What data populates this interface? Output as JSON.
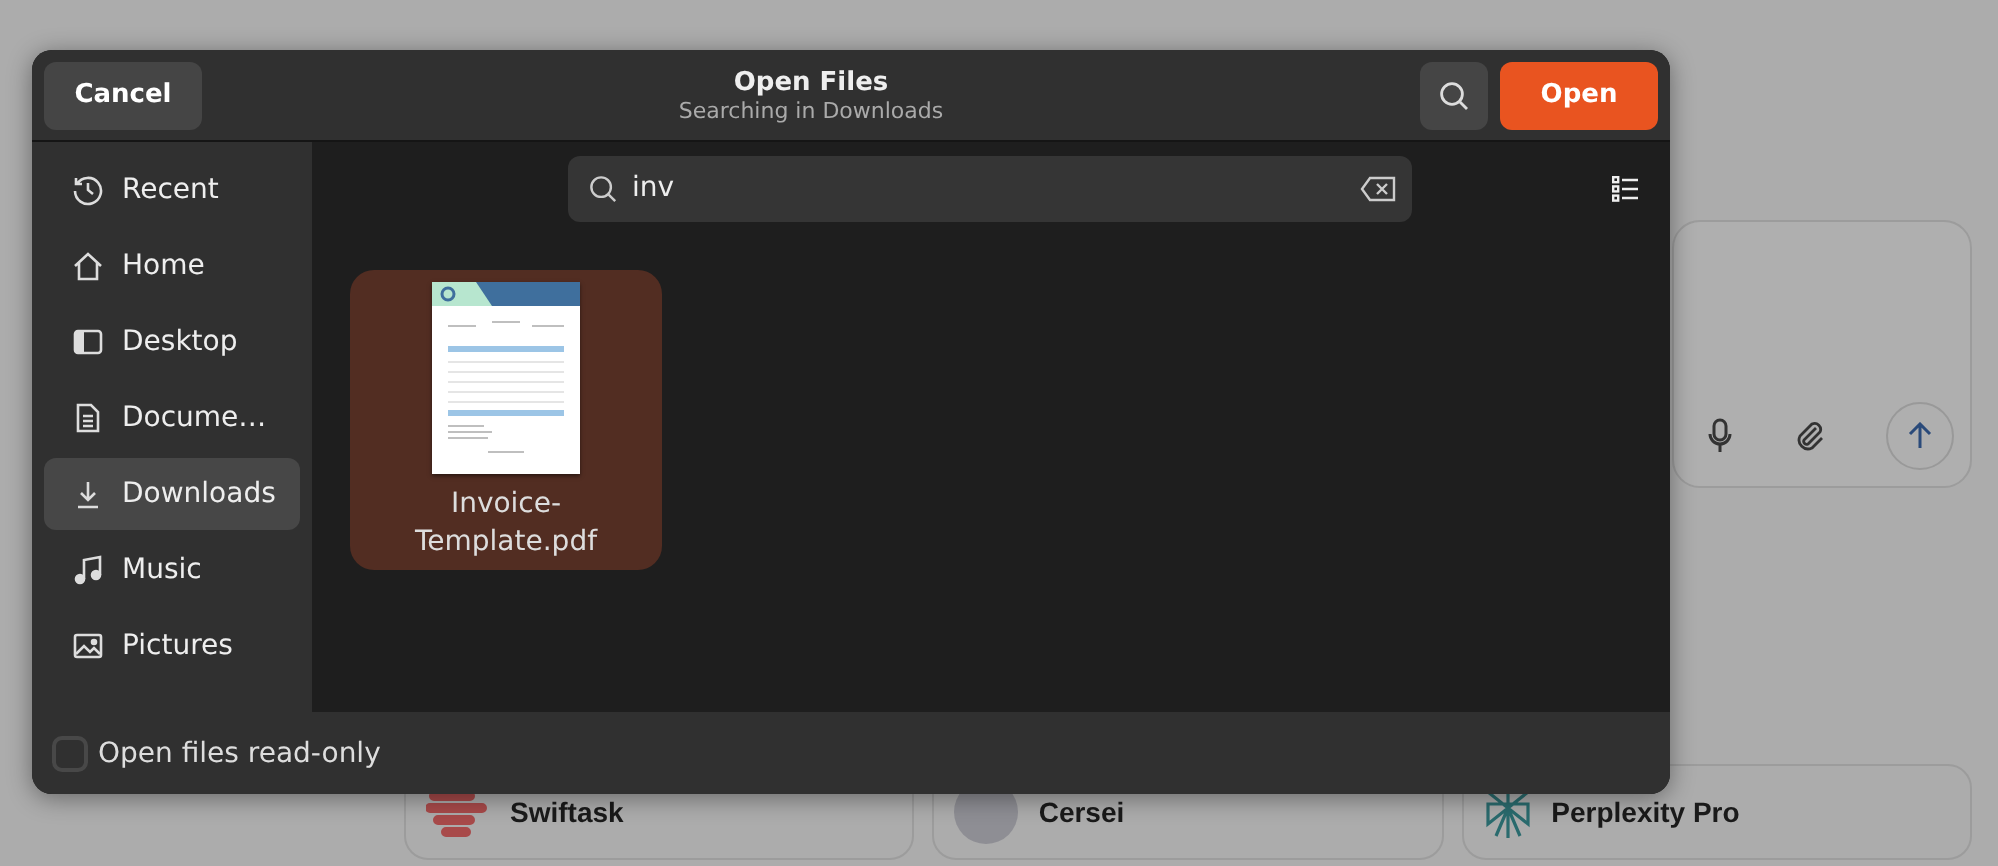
{
  "dialog": {
    "title": "Open Files",
    "subtitle": "Searching in Downloads",
    "cancel_button": "Cancel",
    "open_button": "Open",
    "search": {
      "value": "inv"
    },
    "sidebar": {
      "items": [
        {
          "label": "Recent",
          "kind": "recent",
          "selected": false
        },
        {
          "label": "Home",
          "kind": "home",
          "selected": false
        },
        {
          "label": "Desktop",
          "kind": "desktop",
          "selected": false
        },
        {
          "label": "Docume…",
          "kind": "document",
          "selected": false
        },
        {
          "label": "Downloads",
          "kind": "download",
          "selected": true
        },
        {
          "label": "Music",
          "kind": "music",
          "selected": false
        },
        {
          "label": "Pictures",
          "kind": "pictures",
          "selected": false
        }
      ]
    },
    "files": [
      {
        "name": "Invoice-\nTemplate.pdf",
        "selected": true
      }
    ],
    "read_only": {
      "label": "Open files read-only",
      "checked": false
    }
  },
  "background": {
    "assistants": [
      {
        "name": "Swiftask",
        "kind": "logo"
      },
      {
        "name": "Cersei",
        "kind": "avatar"
      },
      {
        "name": "Perplexity Pro",
        "kind": "emblem"
      }
    ]
  }
}
